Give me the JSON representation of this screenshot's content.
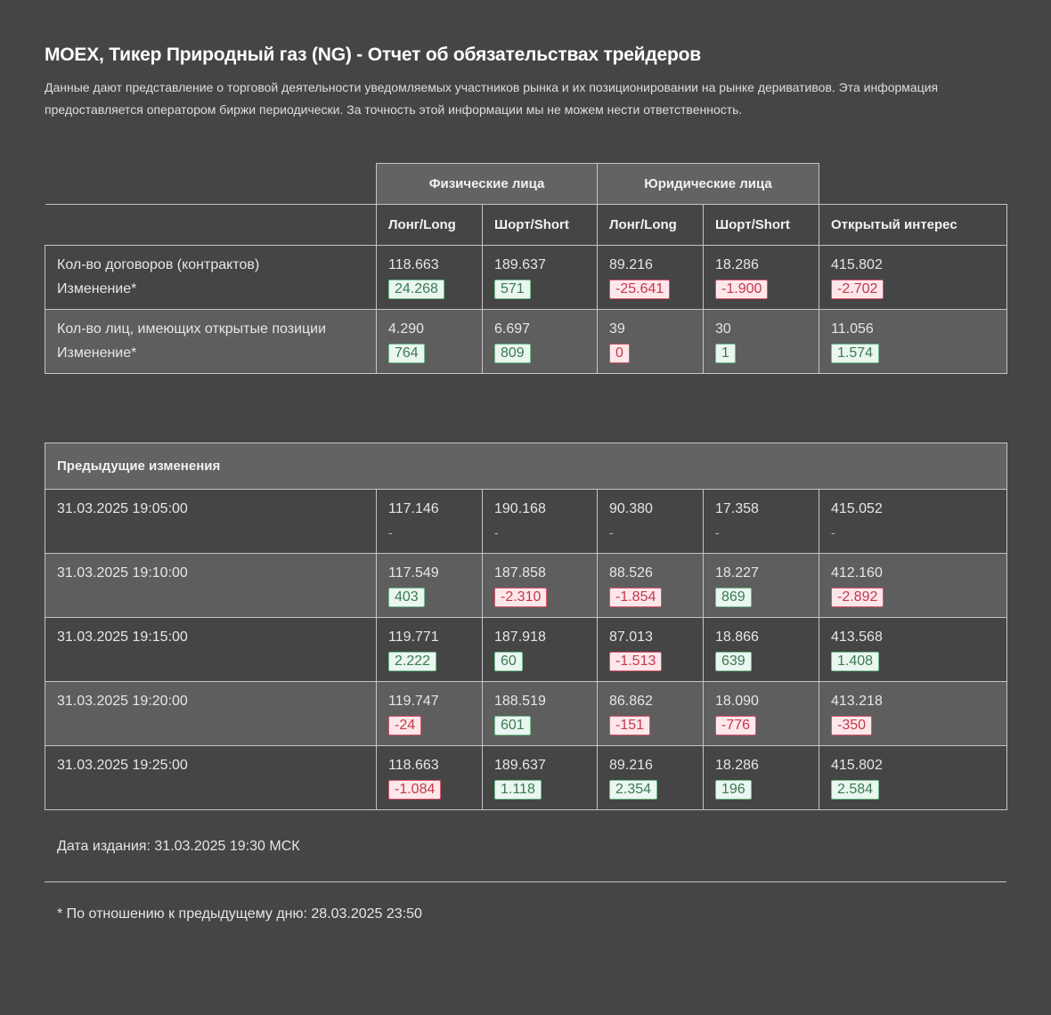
{
  "title": "MOEX, Тикер Природный газ (NG) - Отчет об обязательствах трейдеров",
  "description": "Данные дают представление о торговой деятельности уведомляемых участников рынка и их позиционировании на рынке деривативов. Эта информация предоставляется оператором биржи периодически. За точность этой информации мы не можем нести ответственность.",
  "summary": {
    "group_headers": [
      "Физические лица",
      "Юридические лица"
    ],
    "columns": [
      "Лонг/Long",
      "Шорт/Short",
      "Лонг/Long",
      "Шорт/Short",
      "Открытый интерес"
    ],
    "rows": [
      {
        "label": "Кол-во договоров (контрактов)",
        "sublabel": "Изменение*",
        "values": [
          "118.663",
          "189.637",
          "89.216",
          "18.286",
          "415.802"
        ],
        "changes": [
          "24.268",
          "571",
          "-25.641",
          "-1.900",
          "-2.702"
        ],
        "signs": [
          "pos",
          "pos",
          "neg",
          "neg",
          "neg"
        ]
      },
      {
        "label": "Кол-во лиц, имеющих открытые позиции",
        "sublabel": "Изменение*",
        "values": [
          "4.290",
          "6.697",
          "39",
          "30",
          "11.056"
        ],
        "changes": [
          "764",
          "809",
          "0",
          "1",
          "1.574"
        ],
        "signs": [
          "pos",
          "pos",
          "neg",
          "pos",
          "pos"
        ]
      }
    ]
  },
  "history": {
    "heading": "Предыдущие изменения",
    "rows": [
      {
        "time": "31.03.2025 19:05:00",
        "values": [
          "117.146",
          "190.168",
          "90.380",
          "17.358",
          "415.052"
        ],
        "changes": [
          "-",
          "-",
          "-",
          "-",
          "-"
        ],
        "signs": [
          "none",
          "none",
          "none",
          "none",
          "none"
        ]
      },
      {
        "time": "31.03.2025 19:10:00",
        "values": [
          "117.549",
          "187.858",
          "88.526",
          "18.227",
          "412.160"
        ],
        "changes": [
          "403",
          "-2.310",
          "-1.854",
          "869",
          "-2.892"
        ],
        "signs": [
          "pos",
          "neg",
          "neg",
          "pos",
          "neg"
        ]
      },
      {
        "time": "31.03.2025 19:15:00",
        "values": [
          "119.771",
          "187.918",
          "87.013",
          "18.866",
          "413.568"
        ],
        "changes": [
          "2.222",
          "60",
          "-1.513",
          "639",
          "1.408"
        ],
        "signs": [
          "pos",
          "pos",
          "neg",
          "pos",
          "pos"
        ]
      },
      {
        "time": "31.03.2025 19:20:00",
        "values": [
          "119.747",
          "188.519",
          "86.862",
          "18.090",
          "413.218"
        ],
        "changes": [
          "-24",
          "601",
          "-151",
          "-776",
          "-350"
        ],
        "signs": [
          "neg",
          "pos",
          "neg",
          "neg",
          "neg"
        ]
      },
      {
        "time": "31.03.2025 19:25:00",
        "values": [
          "118.663",
          "189.637",
          "89.216",
          "18.286",
          "415.802"
        ],
        "changes": [
          "-1.084",
          "1.118",
          "2.354",
          "196",
          "2.584"
        ],
        "signs": [
          "neg",
          "pos",
          "pos",
          "pos",
          "pos"
        ]
      }
    ]
  },
  "publication": "Дата издания: 31.03.2025 19:30 МСК",
  "footnote": "* По отношению к предыдущему дню: 28.03.2025 23:50",
  "colors": {
    "background": "#454545",
    "positive_bg": "#eaf6ef",
    "positive_text": "#3b7a52",
    "negative_bg": "#fde7ea",
    "negative_text": "#c23a4d"
  }
}
